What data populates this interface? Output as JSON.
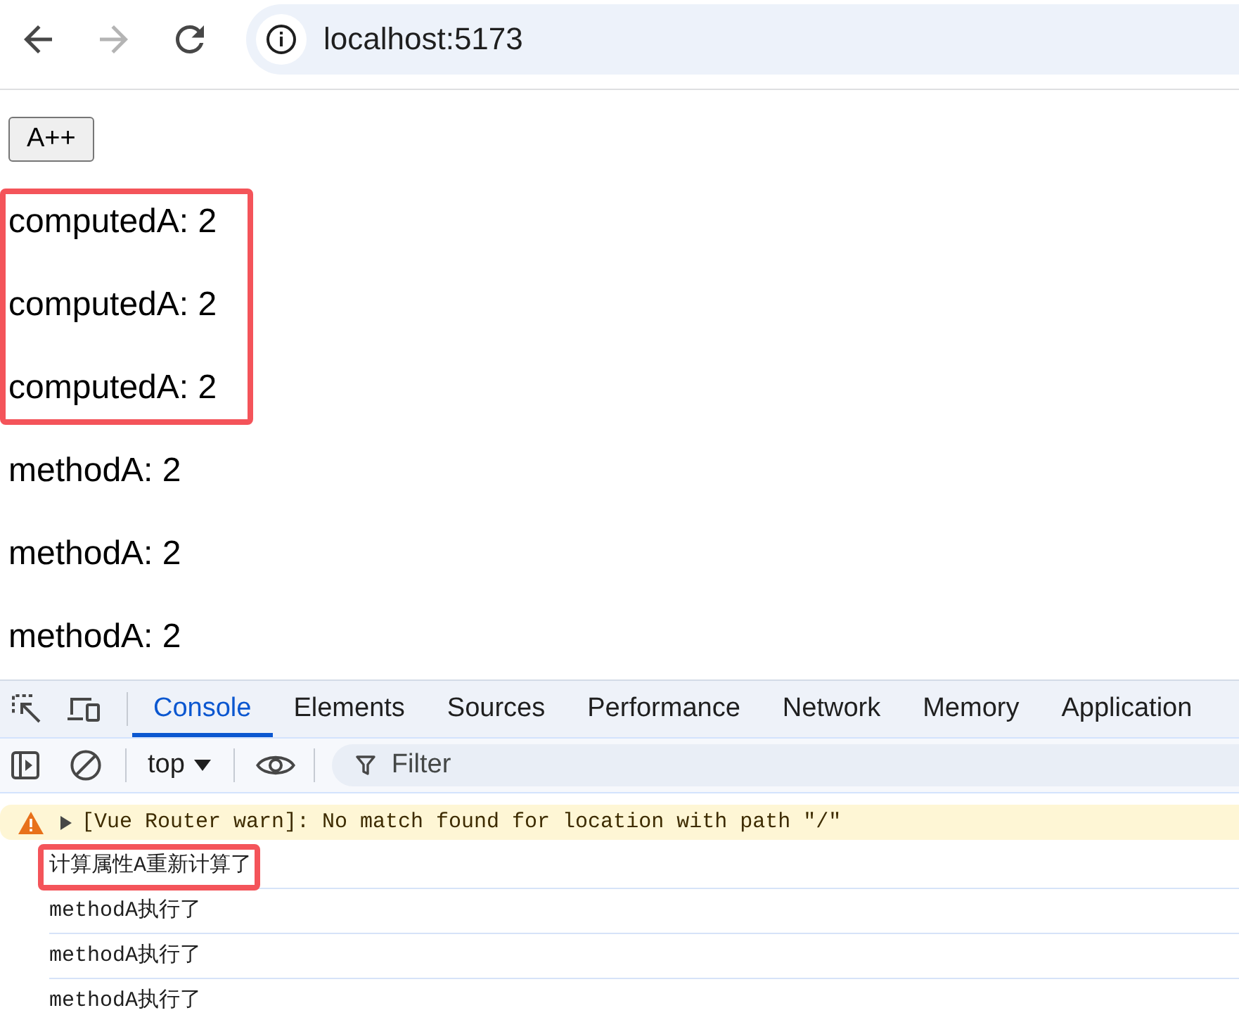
{
  "browser": {
    "nav_buttons": [
      {
        "kind": "back",
        "disabled": false
      },
      {
        "kind": "forward",
        "disabled": true
      },
      {
        "kind": "reload",
        "disabled": false
      }
    ],
    "address": "localhost:5173"
  },
  "page": {
    "button": "A++",
    "groups": [
      {
        "highlighted": true,
        "lines": [
          "computedA: 2",
          "computedA: 2",
          "computedA: 2"
        ]
      },
      {
        "highlighted": false,
        "lines": [
          "methodA: 2",
          "methodA: 2",
          "methodA: 2"
        ]
      }
    ]
  },
  "devtools": {
    "tabs": [
      {
        "label": "Console",
        "selected": true
      },
      {
        "label": "Elements",
        "selected": false
      },
      {
        "label": "Sources",
        "selected": false
      },
      {
        "label": "Performance",
        "selected": false
      },
      {
        "label": "Network",
        "selected": false
      },
      {
        "label": "Memory",
        "selected": false
      },
      {
        "label": "Application",
        "selected": false
      }
    ],
    "toolbar": {
      "context": "top",
      "filter": {
        "placeholder": "Filter"
      }
    },
    "messages": [
      {
        "kind": "warning",
        "text": "[Vue Router warn]: No match found for location with path \"/\"",
        "highlighted": false
      },
      {
        "kind": "log",
        "text": "计算属性A重新计算了",
        "highlighted": true
      },
      {
        "kind": "log",
        "text": "methodA执行了",
        "highlighted": false
      },
      {
        "kind": "log",
        "text": "methodA执行了",
        "highlighted": false
      },
      {
        "kind": "log",
        "text": "methodA执行了",
        "highlighted": false
      }
    ]
  }
}
